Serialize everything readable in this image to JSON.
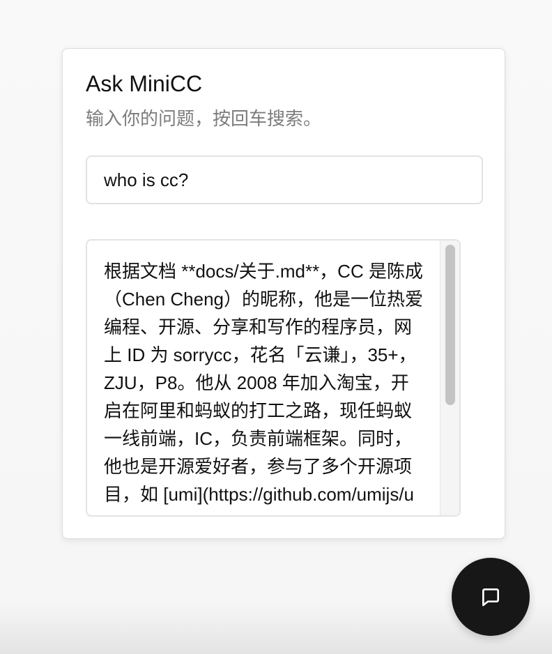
{
  "widget": {
    "title": "Ask MiniCC",
    "subtitle": "输入你的问题，按回车搜索。"
  },
  "search": {
    "value": "who is cc?",
    "placeholder": ""
  },
  "answer": {
    "text": "根据文档 **docs/关于.md**，CC 是陈成（Chen Cheng）的昵称，他是一位热爱编程、开源、分享和写作的程序员，网上 ID 为 sorrycc，花名「云谦」，35+，ZJU，P8。他从 2008 年加入淘宝，开启在阿里和蚂蚁的打工之路，现任蚂蚁一线前端，IC，负责前端框架。同时，他也是开源爱好者，参与了多个开源项目，如 [umi](https://github.com/umijs/umi)、[dva](https://github.com/dvajs/dva) 等。"
  },
  "chat_button": {
    "icon": "chat-bubble-icon"
  },
  "colors": {
    "fab_background": "#171717",
    "card_background": "#ffffff",
    "subtitle_text": "#7c7c7c"
  }
}
